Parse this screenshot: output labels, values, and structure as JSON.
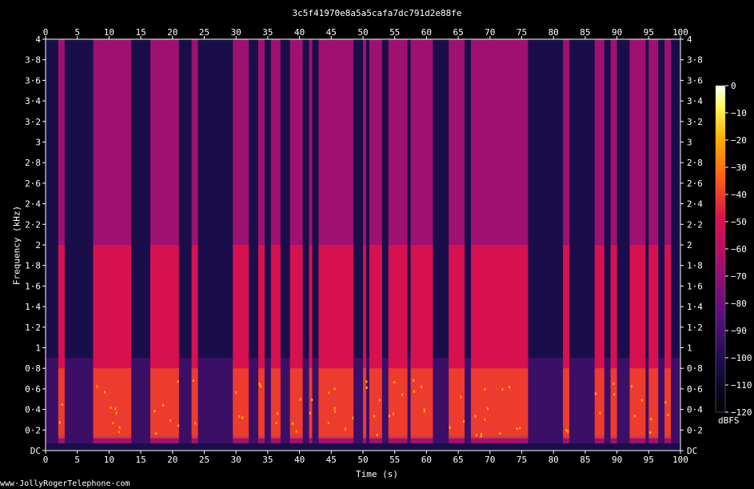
{
  "chart_data": {
    "type": "heatmap",
    "title": "3c5f41970e8a5a5cafa7dc791d2e88fe",
    "xlabel": "Time (s)",
    "ylabel": "Frequency (kHz)",
    "xlim": [
      0,
      100
    ],
    "ylim": [
      0,
      4
    ],
    "x_ticks": [
      "0",
      "5",
      "10",
      "15",
      "20",
      "25",
      "30",
      "35",
      "40",
      "45",
      "50",
      "55",
      "60",
      "65",
      "70",
      "75",
      "80",
      "85",
      "90",
      "95",
      "100"
    ],
    "y_ticks": [
      "DC",
      "0·2",
      "0·4",
      "0·6",
      "0·8",
      "1",
      "1·2",
      "1·4",
      "1·6",
      "1·8",
      "2",
      "2·2",
      "2·4",
      "2·6",
      "2·8",
      "3",
      "3·2",
      "3·4",
      "3·6",
      "3·8",
      "4"
    ],
    "colorbar": {
      "unit": "dBFS",
      "ticks": [
        "0",
        "−10",
        "−20",
        "−30",
        "−40",
        "−50",
        "−60",
        "−70",
        "−80",
        "−90",
        "−100",
        "−110",
        "−120"
      ],
      "range": [
        -120,
        0
      ]
    },
    "colors": [
      "#000000",
      "#1a0e4a",
      "#5a1080",
      "#a01070",
      "#e0104a",
      "#ff6010",
      "#ffb000",
      "#ffff60",
      "#ffffff"
    ],
    "active_segments_s": [
      [
        2,
        3
      ],
      [
        7.5,
        13.5
      ],
      [
        16.5,
        21
      ],
      [
        23,
        24
      ],
      [
        29.5,
        32
      ],
      [
        33.5,
        34.5
      ],
      [
        35.5,
        37
      ],
      [
        38.5,
        40.5
      ],
      [
        41.5,
        42
      ],
      [
        43,
        48.5
      ],
      [
        50,
        50.5
      ],
      [
        51,
        53
      ],
      [
        54,
        57
      ],
      [
        57.5,
        61
      ],
      [
        63.5,
        66
      ],
      [
        67,
        76
      ],
      [
        81.5,
        82.5
      ],
      [
        86.5,
        88
      ],
      [
        89,
        90
      ],
      [
        92,
        94.5
      ],
      [
        95,
        96.5
      ],
      [
        97.5,
        98.5
      ]
    ]
  },
  "footer": {
    "credit": "www·JollyRogerTelephone·com"
  }
}
